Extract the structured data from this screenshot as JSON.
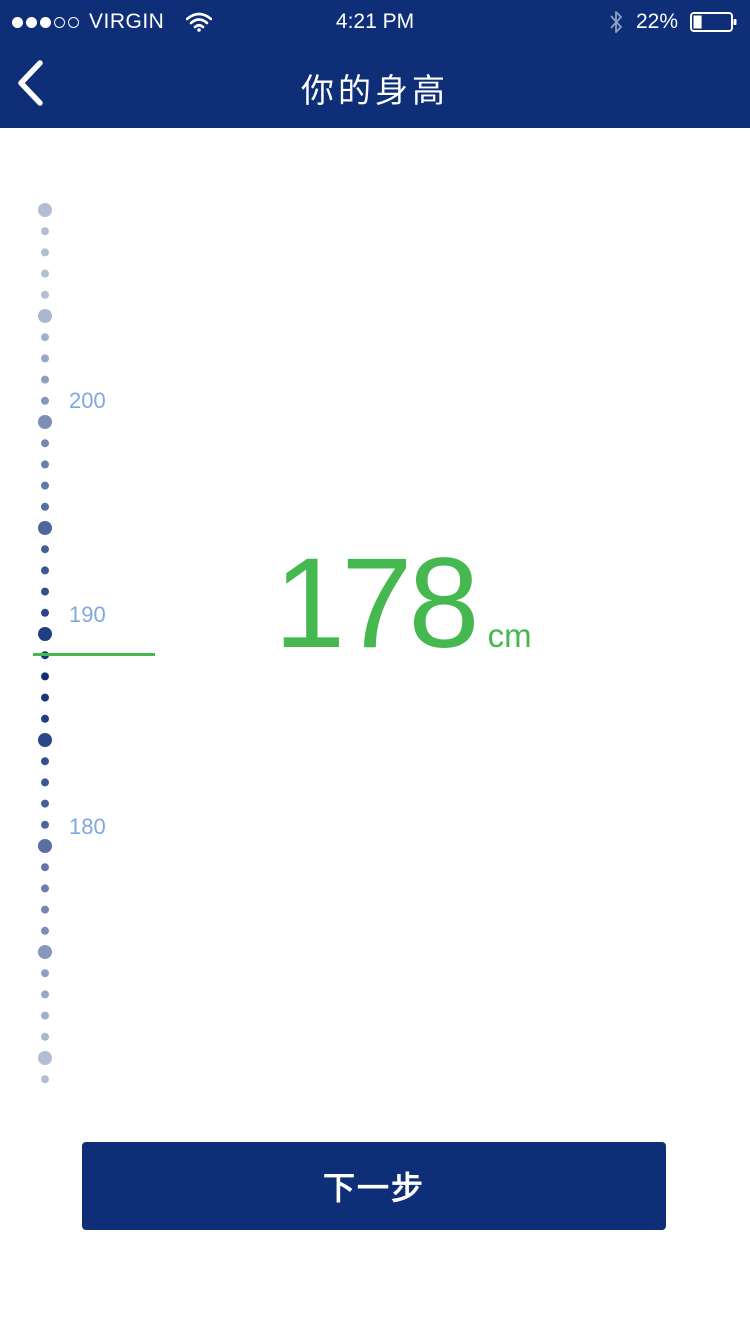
{
  "status_bar": {
    "signal_full": 3,
    "signal_empty": 2,
    "carrier": "VIRGIN",
    "time": "4:21 PM",
    "battery_percent": "22%",
    "battery_level": 0.22,
    "icons": [
      "wifi-icon",
      "bluetooth-icon",
      "battery-icon"
    ]
  },
  "nav": {
    "title": "你的身高",
    "back_icon": "chevron-left-icon"
  },
  "ruler": {
    "labels": [
      "200",
      "190",
      "180"
    ],
    "range_cm": [
      168,
      210
    ],
    "major_every_cm": 5,
    "selected_cm": 188,
    "colors": {
      "near": "#0e2f78",
      "far": "#b3bed4",
      "label": "#7fa8e0",
      "indicator": "#45b94f"
    }
  },
  "reading": {
    "value": "178",
    "unit": "cm",
    "color": "#45b94f"
  },
  "next_button": {
    "label": "下一步",
    "color": "#0e2f78"
  }
}
